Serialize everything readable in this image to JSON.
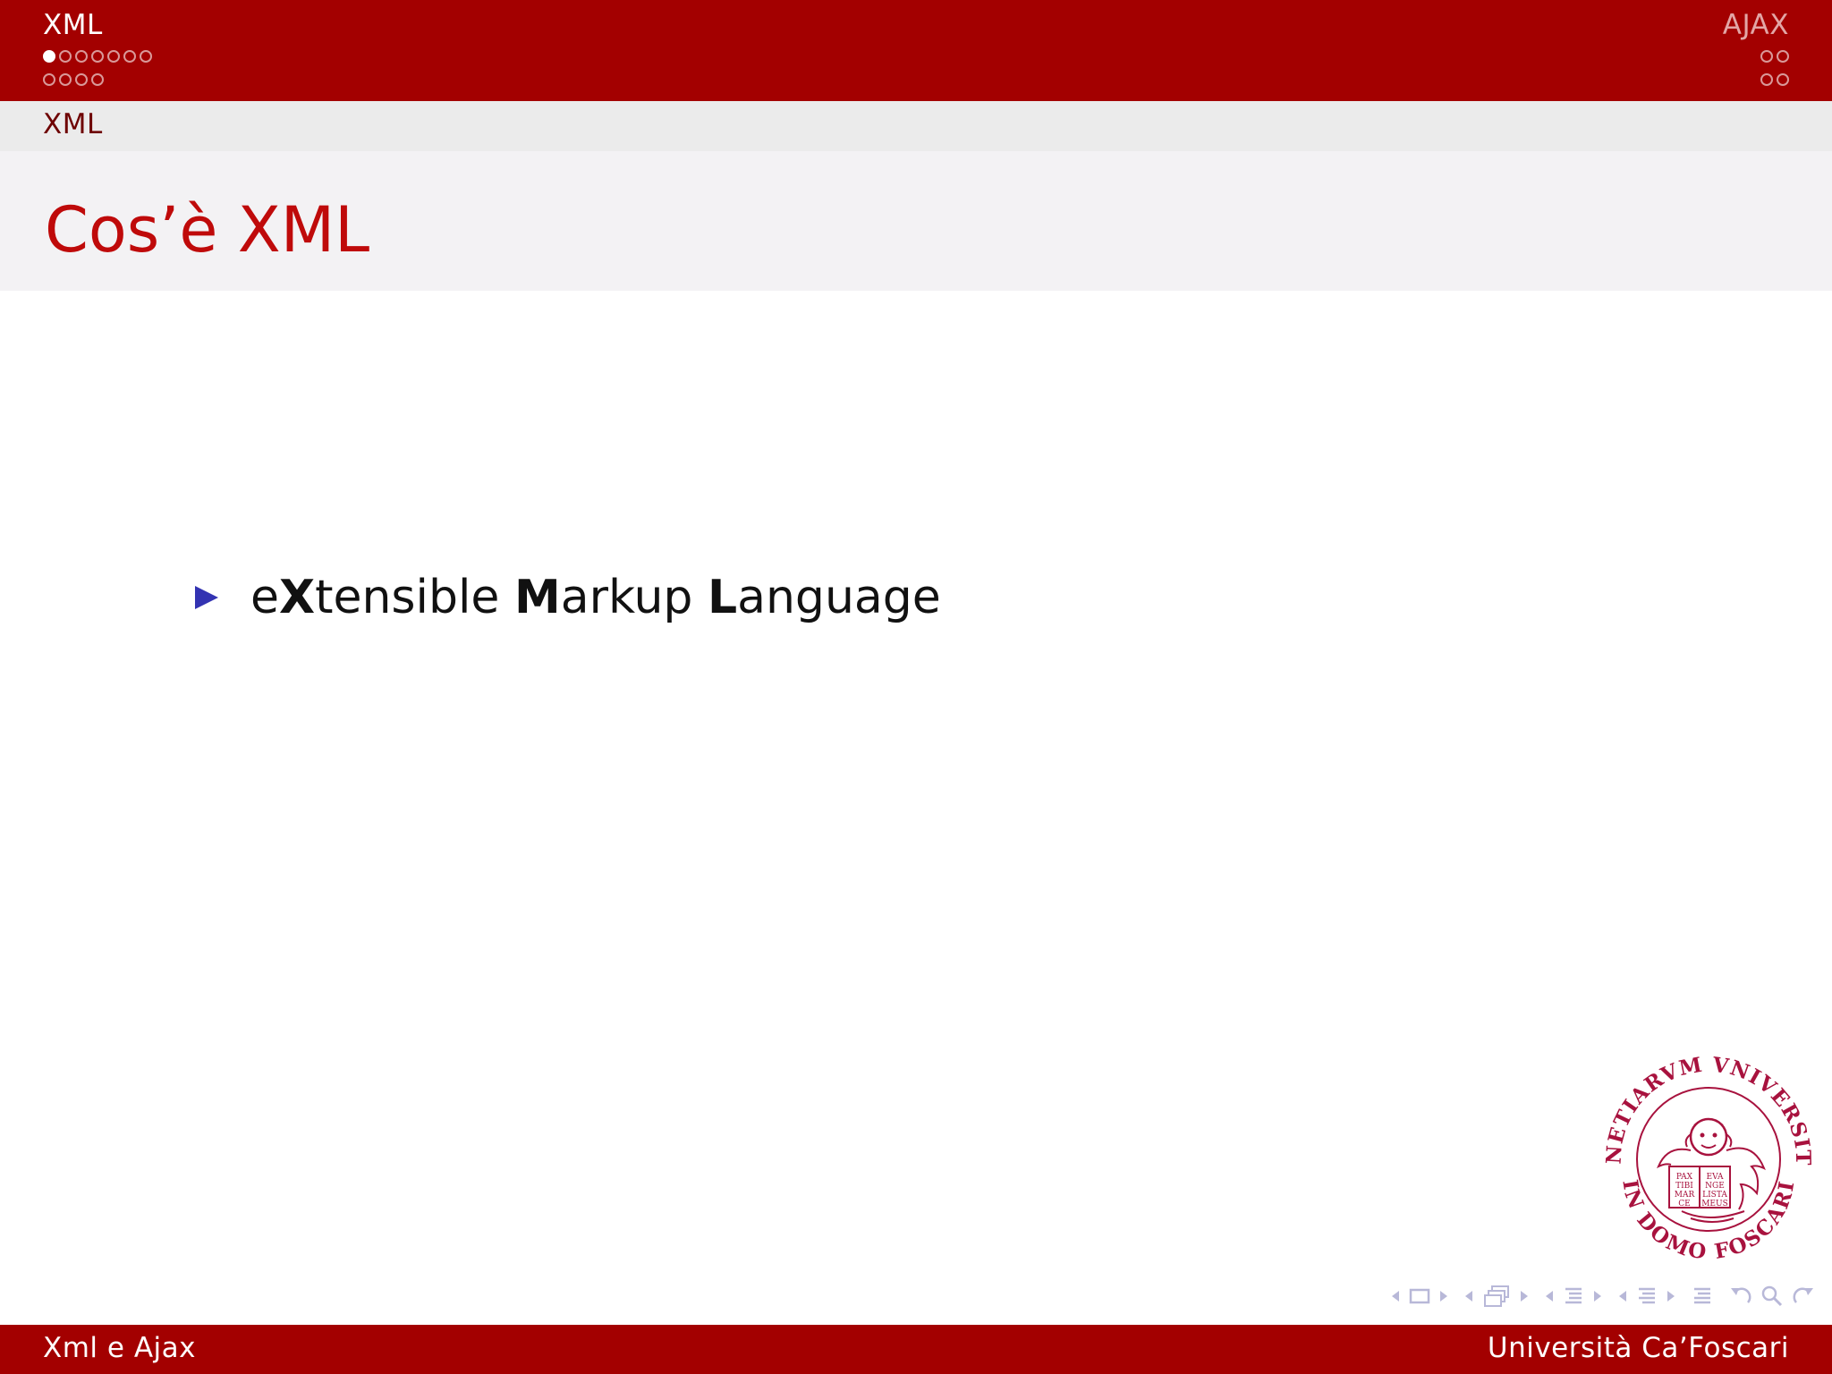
{
  "header": {
    "left_section": "XML",
    "left_dots_row1": 7,
    "left_dots_row1_current": 0,
    "left_dots_row2": 4,
    "right_section": "AJAX",
    "right_dots_row1": 2,
    "right_dots_row2": 2
  },
  "subsection": "XML",
  "slide": {
    "title": "Cos’è XML",
    "bullet": {
      "p1": "e",
      "b1": "X",
      "p2": "tensible ",
      "b2": "M",
      "p3": "arkup ",
      "b3": "L",
      "p4": "anguage"
    }
  },
  "seal": {
    "outer_text": "VENETIARVM VNIVERSITAS",
    "inner_text": "IN DOMO FOSCARI",
    "book_left": [
      "PAX",
      "TIBI",
      "MAR",
      "CE"
    ],
    "book_right": [
      "EVA",
      "NGE",
      "LISTA",
      "MEUS"
    ],
    "color": "#a8123e"
  },
  "nav_icons": [
    "nav-frame-icon",
    "nav-subsection-icon",
    "nav-section-icon",
    "nav-document-icon",
    "nav-back-icon",
    "nav-search-icon",
    "nav-forward-icon"
  ],
  "footer": {
    "left": "Xml e Ajax",
    "right": "Università Ca’Foscari"
  },
  "colors": {
    "brand_red": "#a30000",
    "title_red": "#bf0a0a",
    "bullet_blue": "#3333b2"
  }
}
